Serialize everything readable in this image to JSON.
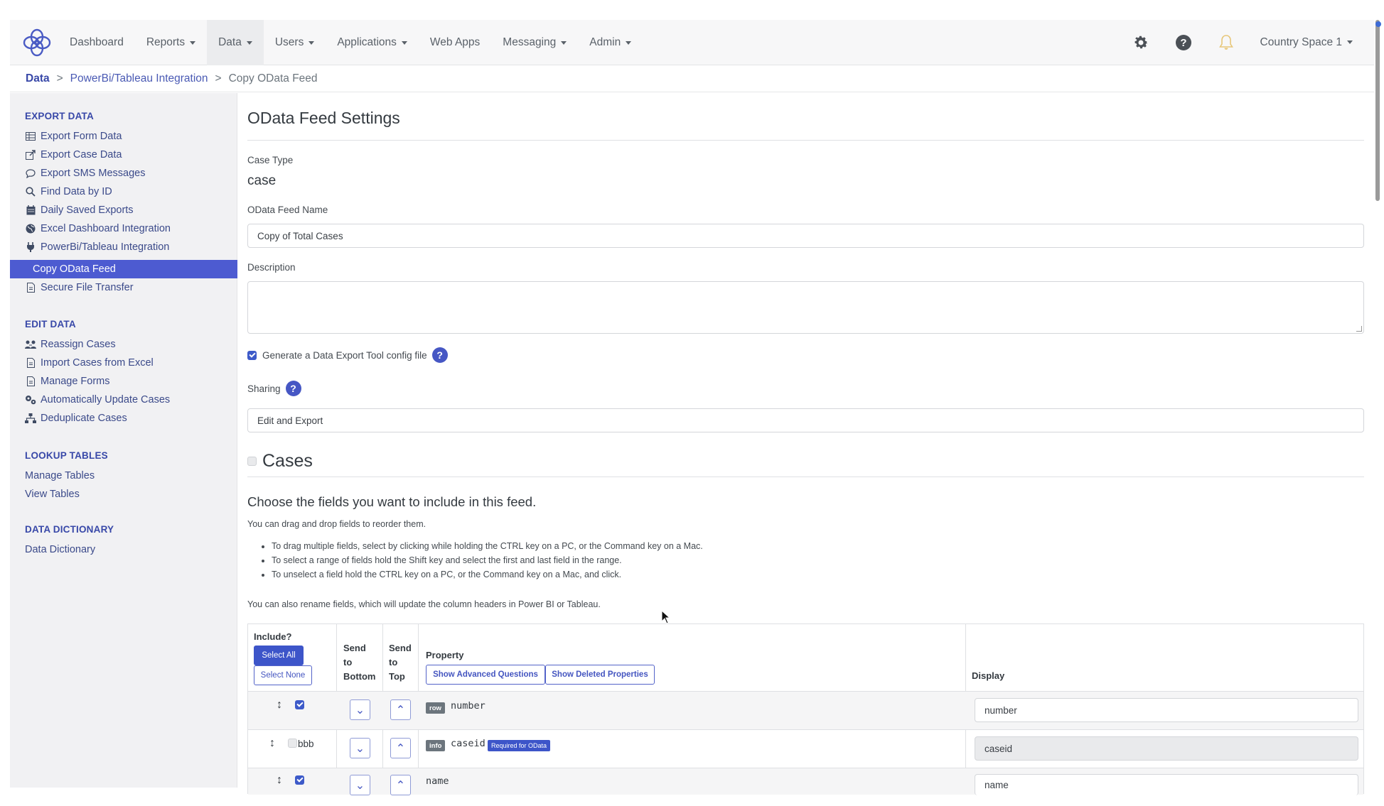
{
  "nav": {
    "items": [
      {
        "label": "Dashboard",
        "has_caret": false
      },
      {
        "label": "Reports",
        "has_caret": true
      },
      {
        "label": "Data",
        "has_caret": true,
        "active": true
      },
      {
        "label": "Users",
        "has_caret": true
      },
      {
        "label": "Applications",
        "has_caret": true
      },
      {
        "label": "Web Apps",
        "has_caret": false
      },
      {
        "label": "Messaging",
        "has_caret": true
      },
      {
        "label": "Admin",
        "has_caret": true
      }
    ],
    "space": "Country Space 1",
    "icons": [
      "gear-icon",
      "help-icon",
      "bell-icon"
    ]
  },
  "breadcrumb": {
    "root": "Data",
    "parent": "PowerBi/Tableau Integration",
    "current": "Copy OData Feed",
    "separator": ">"
  },
  "sidebar": {
    "sections": [
      {
        "heading": "EXPORT DATA",
        "items": [
          {
            "label": "Export Form Data",
            "icon": "table-icon"
          },
          {
            "label": "Export Case Data",
            "icon": "export-icon"
          },
          {
            "label": "Export SMS Messages",
            "icon": "comment-icon"
          },
          {
            "label": "Find Data by ID",
            "icon": "search-icon"
          },
          {
            "label": "Daily Saved Exports",
            "icon": "calendar-icon"
          },
          {
            "label": "Excel Dashboard Integration",
            "icon": "globe-icon"
          },
          {
            "label": "PowerBi/Tableau Integration",
            "icon": "plug-icon"
          },
          {
            "label": "Copy OData Feed",
            "icon": "",
            "active": true
          },
          {
            "label": "Secure File Transfer",
            "icon": "file-icon"
          }
        ]
      },
      {
        "heading": "EDIT DATA",
        "items": [
          {
            "label": "Reassign Cases",
            "icon": "users-icon"
          },
          {
            "label": "Import Cases from Excel",
            "icon": "file-icon"
          },
          {
            "label": "Manage Forms",
            "icon": "file-icon"
          },
          {
            "label": "Automatically Update Cases",
            "icon": "cogs-icon"
          },
          {
            "label": "Deduplicate Cases",
            "icon": "sitemap-icon"
          }
        ]
      },
      {
        "heading": "LOOKUP TABLES",
        "items": [
          {
            "label": "Manage Tables",
            "icon": ""
          },
          {
            "label": "View Tables",
            "icon": ""
          }
        ]
      },
      {
        "heading": "DATA DICTIONARY",
        "items": [
          {
            "label": "Data Dictionary",
            "icon": ""
          }
        ]
      }
    ]
  },
  "main": {
    "title": "OData Feed Settings",
    "case_type_label": "Case Type",
    "case_type_value": "case",
    "feed_name_label": "OData Feed Name",
    "feed_name_value": "Copy of Total Cases",
    "description_label": "Description",
    "description_value": "",
    "generate_config_label": "Generate a Data Export Tool config file",
    "generate_config_checked": true,
    "sharing_label": "Sharing",
    "sharing_value": "Edit and Export",
    "cases_section_title": "Cases",
    "choose_fields_title": "Choose the fields you want to include in this feed.",
    "drag_drop_text": "You can drag and drop fields to reorder them.",
    "bullets": [
      "To drag multiple fields, select by clicking while holding the CTRL key on a PC, or the Command key on a Mac.",
      "To select a range of fields hold the Shift key and select the first and last field in the range.",
      "To unselect a field hold the CTRL key on a PC, or the Command key on a Mac, and click."
    ],
    "rename_text": "You can also rename fields, which will update the column headers in Power BI or Tableau."
  },
  "table": {
    "headers": {
      "include": "Include?",
      "select_all": "Select All",
      "select_none": "Select None",
      "send_to_bottom": [
        "Send",
        "to",
        "Bottom"
      ],
      "send_to_top": [
        "Send",
        "to",
        "Top"
      ],
      "property": "Property",
      "show_advanced": "Show Advanced Questions",
      "show_deleted": "Show Deleted Properties",
      "display": "Display"
    },
    "rows": [
      {
        "checked": true,
        "extra_label": "",
        "tag": "row",
        "property": "number",
        "badge": "",
        "display": "number",
        "readonly": false
      },
      {
        "checked": false,
        "extra_label": "bbb",
        "tag": "info",
        "property": "caseid",
        "badge": "Required for OData",
        "display": "caseid",
        "readonly": true
      },
      {
        "checked": true,
        "extra_label": "",
        "tag": "",
        "property": "name",
        "badge": "",
        "display": "name",
        "readonly": false
      }
    ]
  }
}
